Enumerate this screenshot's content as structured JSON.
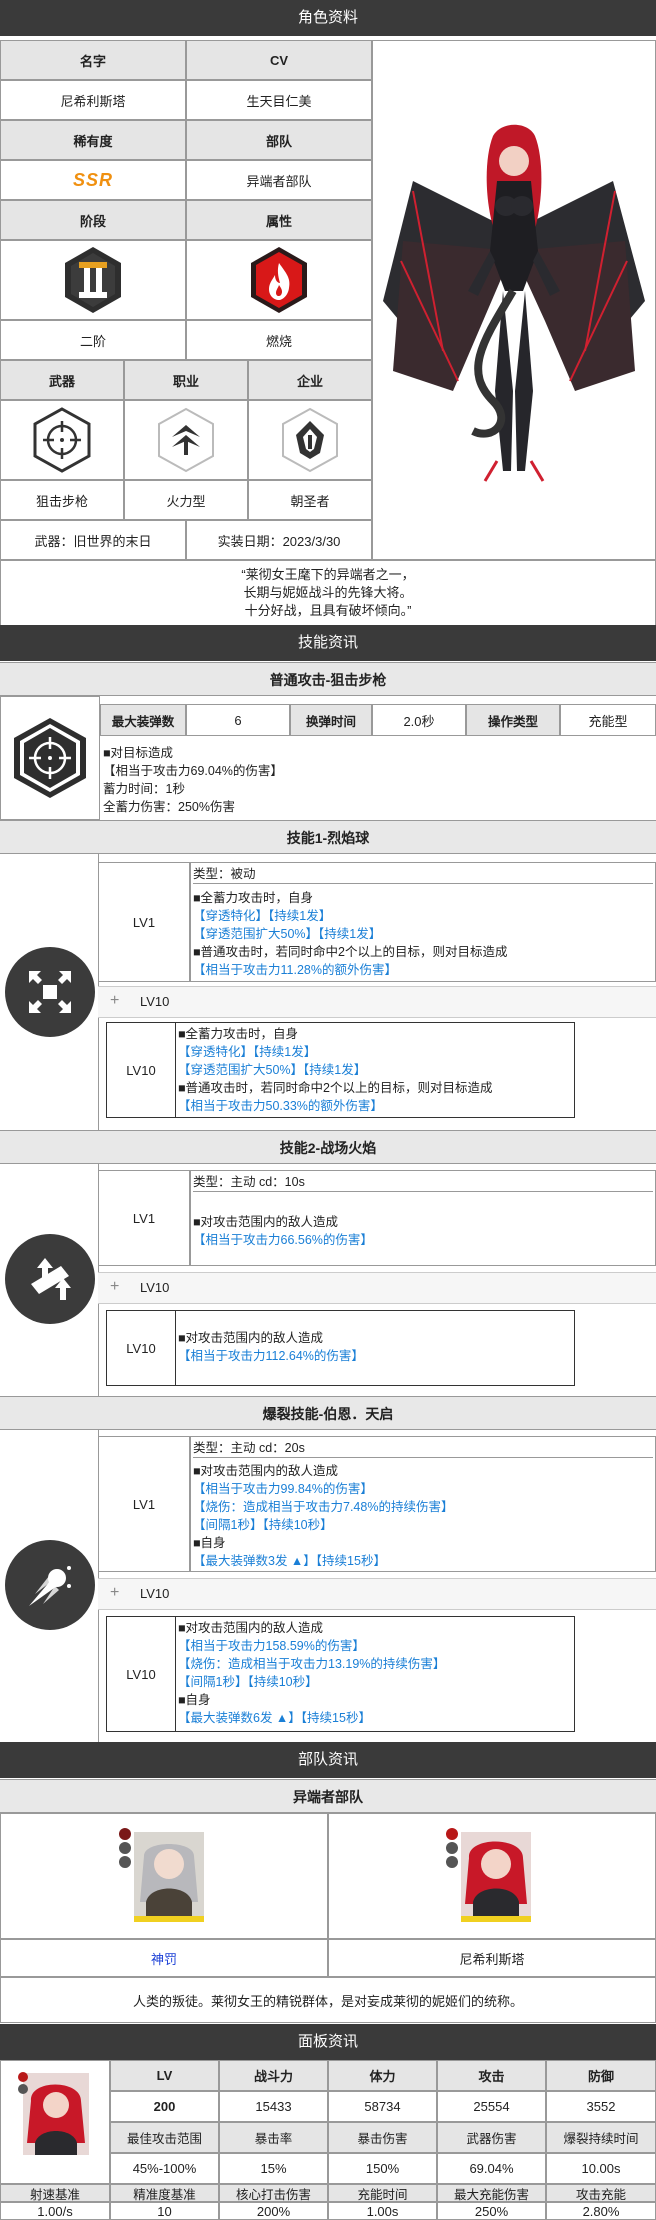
{
  "profile": {
    "header": "角色资料",
    "name_label": "名字",
    "cv_label": "CV",
    "name": "尼希利斯塔",
    "cv": "生天目仁美",
    "rarity_label": "稀有度",
    "squad_label": "部队",
    "rarity": "SSR",
    "squad": "异端者部队",
    "stage_label": "阶段",
    "attr_label": "属性",
    "stage": "二阶",
    "attr": "燃烧",
    "weapon_label": "武器",
    "job_label": "职业",
    "company_label": "企业",
    "weapon": "狙击步枪",
    "job": "火力型",
    "company": "朝圣者",
    "weapon_name": "武器：旧世界的末日",
    "release_date": "实装日期：2023/3/30",
    "quote_lines": [
      "“莱彻女王麾下的异端者之一，",
      "长期与妮姬战斗的先锋大将。",
      "十分好战，且具有破坏倾向。”"
    ]
  },
  "skills": {
    "header": "技能资讯",
    "normal": {
      "title": "普通攻击-狙击步枪",
      "max_ammo_label": "最大装弹数",
      "max_ammo": "6",
      "reload_label": "换弹时间",
      "reload": "2.0秒",
      "control_label": "操作类型",
      "control": "充能型",
      "desc": [
        "■对目标造成",
        "【相当于攻击力69.04%的伤害】",
        "蓄力时间：1秒",
        "全蓄力伤害：250%伤害"
      ]
    },
    "skill1": {
      "title": "技能1-烈焰球",
      "lv1_label": "LV1",
      "lv10_toggle": "LV10",
      "lv10_label": "LV10",
      "type": "类型：被动",
      "lv1": [
        "■全蓄力攻击时，自身",
        "【穿透特化】【持续1发】",
        "【穿透范围扩大50%】【持续1发】",
        "■普通攻击时，若同时命中2个以上的目标，则对目标造成",
        "【相当于攻击力11.28%的额外伤害】"
      ],
      "lv10": [
        "■全蓄力攻击时，自身",
        "【穿透特化】【持续1发】",
        "【穿透范围扩大50%】【持续1发】",
        "■普通攻击时，若同时命中2个以上的目标，则对目标造成",
        "【相当于攻击力50.33%的额外伤害】"
      ]
    },
    "skill2": {
      "title": "技能2-战场火焰",
      "lv1_label": "LV1",
      "lv10_toggle": "LV10",
      "lv10_label": "LV10",
      "type": "类型：主动   cd：10s",
      "lv1": [
        "■对攻击范围内的敌人造成",
        "【相当于攻击力66.56%的伤害】"
      ],
      "lv10": [
        "■对攻击范围内的敌人造成",
        "【相当于攻击力112.64%的伤害】"
      ]
    },
    "burst": {
      "title": "爆裂技能-伯恩．天启",
      "lv1_label": "LV1",
      "lv10_toggle": "LV10",
      "lv10_label": "LV10",
      "type": "类型：主动   cd：20s",
      "lv1": [
        "■对攻击范围内的敌人造成",
        "【相当于攻击力99.84%的伤害】",
        "【烧伤：造成相当于攻击力7.48%的持续伤害】",
        "【间隔1秒】【持续10秒】",
        "■自身",
        "【最大装弹数3发 ▲】【持续15秒】"
      ],
      "lv10": [
        "■对攻击范围内的敌人造成",
        "【相当于攻击力158.59%的伤害】",
        "【烧伤：造成相当于攻击力13.19%的持续伤害】",
        "【间隔1秒】【持续10秒】",
        "■自身",
        "【最大装弹数6发 ▲】【持续15秒】"
      ]
    }
  },
  "squad": {
    "header": "部队资讯",
    "title": "异端者部队",
    "members": [
      {
        "name": "神罚",
        "color": "#1a3fd6"
      },
      {
        "name": "尼希利斯塔",
        "color": "#222222"
      }
    ],
    "desc": "人类的叛徒。莱彻女王的精锐群体，是对妄成莱彻的妮姬们的统称。"
  },
  "stats": {
    "header": "面板资讯",
    "row1_labels": [
      "LV",
      "战斗力",
      "体力",
      "攻击",
      "防御"
    ],
    "row1_values": [
      "200",
      "15433",
      "58734",
      "25554",
      "3552"
    ],
    "row2_labels": [
      "最佳攻击范围",
      "暴击率",
      "暴击伤害",
      "武器伤害",
      "爆裂持续时间"
    ],
    "row2_values": [
      "45%-100%",
      "15%",
      "150%",
      "69.04%",
      "10.00s"
    ],
    "row3_labels": [
      "射速基准",
      "精准度基准",
      "核心打击伤害",
      "充能时间",
      "最大充能伤害",
      "攻击充能"
    ],
    "row3_values": [
      "1.00/s",
      "10",
      "200%",
      "1.00s",
      "250%",
      "2.80%"
    ]
  },
  "colors": {
    "accent_blue": "#1a7fd6",
    "header_dark": "#3a3a3a",
    "fire_red": "#e02020"
  }
}
